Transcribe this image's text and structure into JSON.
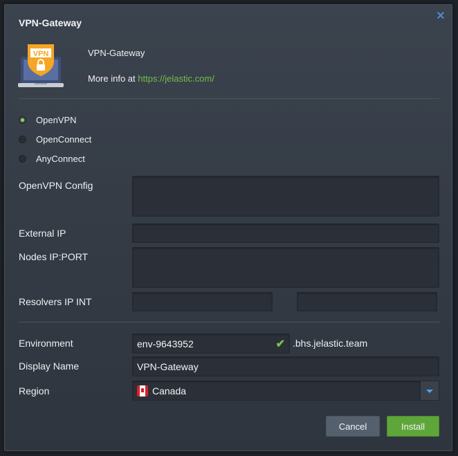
{
  "dialog": {
    "title": "VPN-Gateway",
    "app_name": "VPN-Gateway",
    "more_info_prefix": "More info at ",
    "more_info_link": "https://jelastic.com/",
    "logo_text": "VPN"
  },
  "vpn_types": [
    {
      "label": "OpenVPN",
      "checked": true
    },
    {
      "label": "OpenConnect",
      "checked": false
    },
    {
      "label": "AnyConnect",
      "checked": false
    }
  ],
  "fields": {
    "openvpn_config": {
      "label": "OpenVPN Config",
      "value": ""
    },
    "external_ip": {
      "label": "External IP",
      "value": ""
    },
    "nodes_ip_port": {
      "label": "Nodes IP:PORT",
      "value": ""
    },
    "resolvers_ip_int": {
      "label": "Resolvers IP INT",
      "value1": "",
      "value2": ""
    },
    "environment": {
      "label": "Environment",
      "value": "env-9643952",
      "suffix": ".bhs.jelastic.team"
    },
    "display_name": {
      "label": "Display Name",
      "value": "VPN-Gateway"
    },
    "region": {
      "label": "Region",
      "value": "Canada"
    }
  },
  "buttons": {
    "cancel": "Cancel",
    "install": "Install"
  },
  "colors": {
    "accent_green": "#6fbf4a",
    "install_button": "#5fa63a",
    "close_icon": "#4e8bc8"
  }
}
